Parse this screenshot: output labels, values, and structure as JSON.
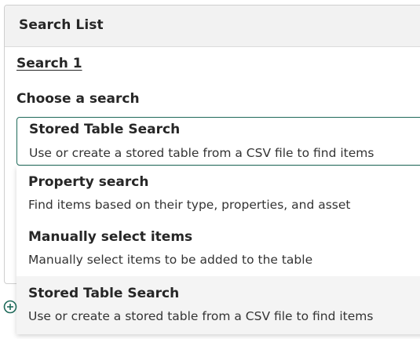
{
  "panel": {
    "title": "Search List"
  },
  "search": {
    "link_label": "Search 1",
    "choose_label": "Choose a search"
  },
  "selected": {
    "title": "Stored Table Search",
    "description": "Use or create a stored table from a CSV file to find items"
  },
  "options": [
    {
      "title": "Property search",
      "description": "Find items based on their type, properties, and asset"
    },
    {
      "title": "Manually select items",
      "description": "Manually select items to be added to the table"
    },
    {
      "title": "Stored Table Search",
      "description": "Use or create a stored table from a CSV file to find items"
    }
  ],
  "icons": {
    "add": "add-circle-icon"
  },
  "colors": {
    "accent": "#1f6a5a",
    "hover_bg": "#f4f4f4",
    "header_bg": "#f2f2f2"
  }
}
